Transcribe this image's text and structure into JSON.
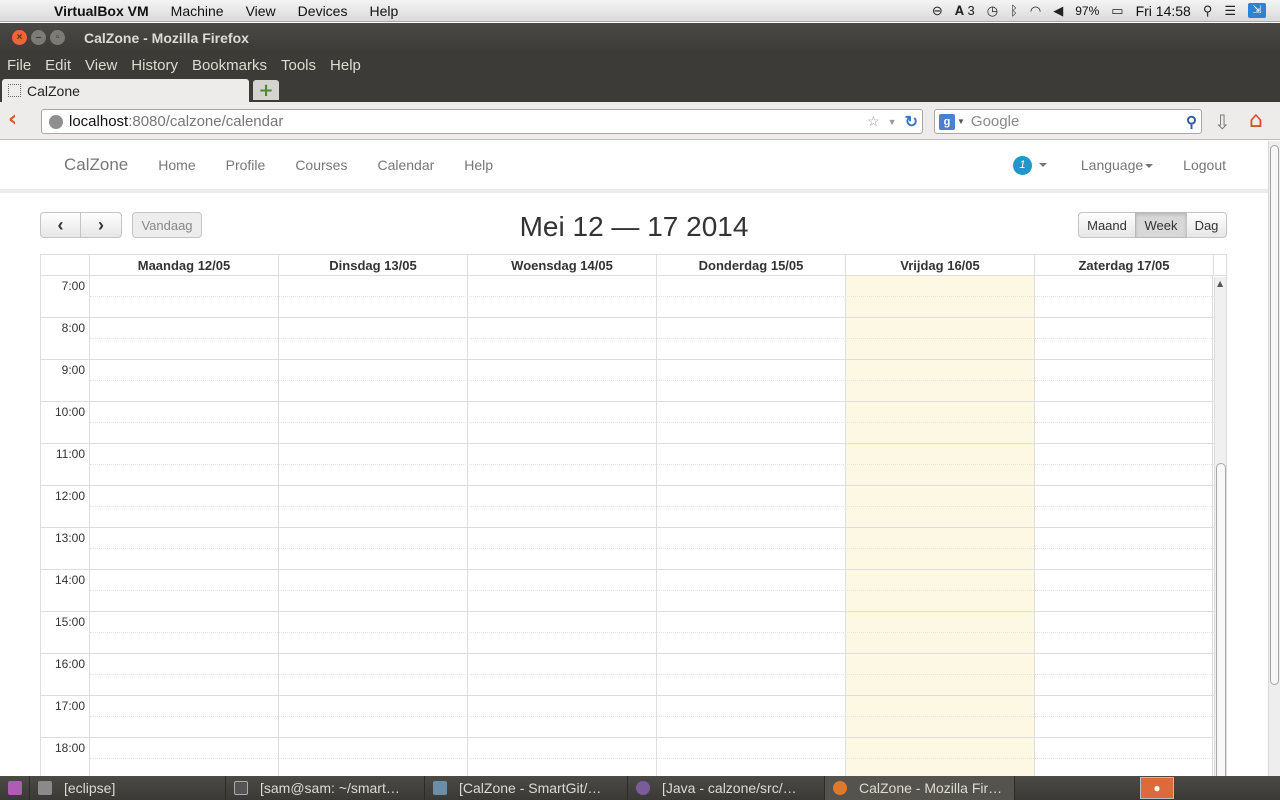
{
  "menubar": {
    "app_name": "VirtualBox VM",
    "items": [
      "Machine",
      "View",
      "Devices",
      "Help"
    ],
    "tray": {
      "adobe_count": "3",
      "battery": "97%",
      "clock": "Fri 14:58"
    }
  },
  "window": {
    "title": "CalZone - Mozilla Firefox"
  },
  "firefox_menu": [
    "File",
    "Edit",
    "View",
    "History",
    "Bookmarks",
    "Tools",
    "Help"
  ],
  "tab": {
    "label": "CalZone"
  },
  "urlbar": {
    "host": "localhost",
    "path": ":8080/calzone/calendar"
  },
  "searchbar": {
    "placeholder": "Google"
  },
  "app": {
    "brand": "CalZone",
    "nav": [
      "Home",
      "Profile",
      "Courses",
      "Calendar",
      "Help"
    ],
    "notification_count": "1",
    "language": "Language",
    "logout": "Logout"
  },
  "calendar": {
    "title": "Mei 12 — 17 2014",
    "today_label": "Vandaag",
    "prev_label": "‹",
    "next_label": "›",
    "views": [
      "Maand",
      "Week",
      "Dag"
    ],
    "active_view": "Week",
    "days": [
      "Maandag 12/05",
      "Dinsdag 13/05",
      "Woensdag 14/05",
      "Donderdag 15/05",
      "Vrijdag 16/05",
      "Zaterdag 17/05"
    ],
    "today_index": 4,
    "times": [
      "7:00",
      "8:00",
      "9:00",
      "10:00",
      "11:00",
      "12:00",
      "13:00",
      "14:00",
      "15:00",
      "16:00",
      "17:00",
      "18:00"
    ],
    "today_color": "#fcf8e3"
  },
  "taskbar": {
    "tasks": [
      "[eclipse]",
      "[sam@sam: ~/smart…",
      "[CalZone - SmartGit/…",
      "[Java - calzone/src/…",
      "CalZone - Mozilla Fir…"
    ]
  }
}
